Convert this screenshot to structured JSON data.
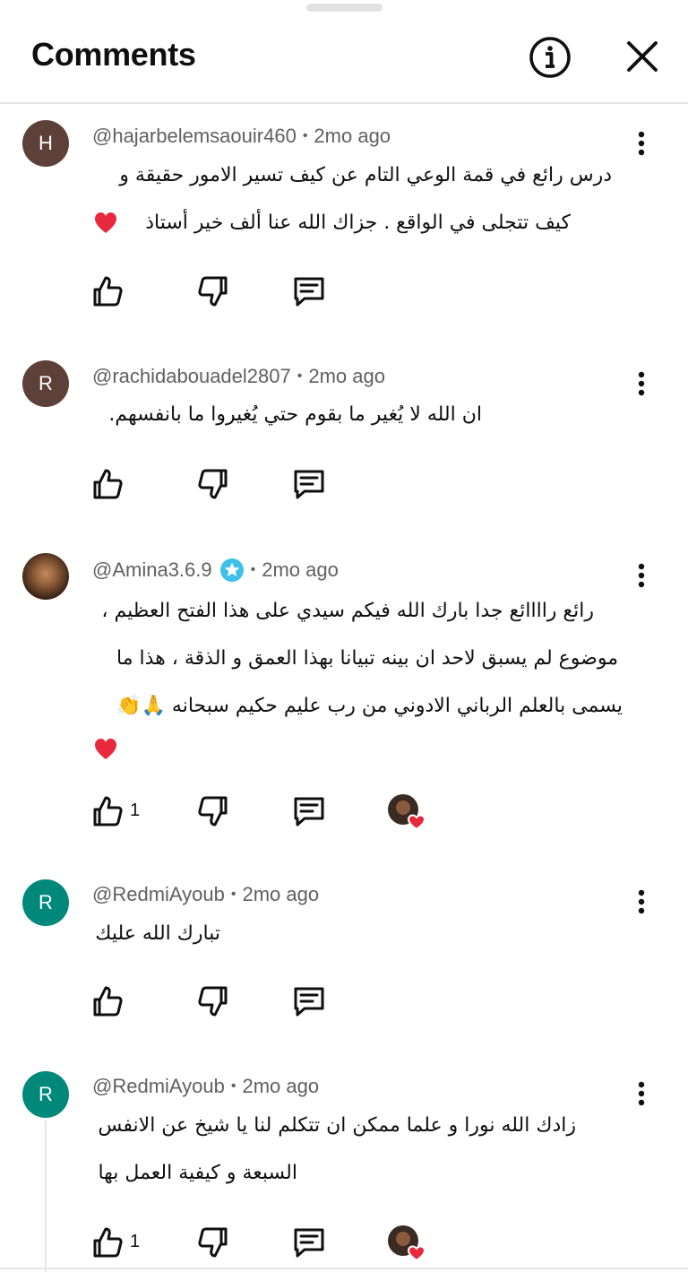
{
  "header": {
    "title": "Comments",
    "info_icon": "info-circle-icon",
    "close_icon": "close-icon"
  },
  "colors": {
    "avatar_brown": "#5d4037",
    "avatar_teal": "#00897b",
    "meta_gray": "#606060",
    "verified_blue": "#3ec0e8",
    "heart_red": "#e8283c"
  },
  "comments": [
    {
      "author": "@hajarbelemsaouir460",
      "time": "2mo ago",
      "avatar_letter": "H",
      "lines": [
        "درس رائع في قمة الوعي التام  عن كيف تسير الامور  حقيقة و",
        "كيف تتجلى في الواقع . جزاك الله عنا ألف خير أستاذ"
      ],
      "likes": ""
    },
    {
      "author": "@rachidabouadel2807",
      "time": "2mo ago",
      "avatar_letter": "R",
      "lines": [
        "ان الله لا يُغير ما بقوم حتي يُغيروا ما بانفسهم."
      ],
      "likes": ""
    },
    {
      "author": "@Amina3.6.9",
      "time": "2mo ago",
      "avatar_letter": "",
      "lines": [
        "رائع راااائع جدا بارك الله فيكم سيدي على هذا الفتح العظيم ،",
        "موضوع لم يسبق لاحد ان بينه تبيانا بهذا العمق و الذقة ، هذا ما",
        "يسمى بالعلم الرباني الادوني من رب عليم حكيم سبحانه 🙏👏"
      ],
      "likes": "1"
    },
    {
      "author": "@RedmiAyoub",
      "time": "2mo ago",
      "avatar_letter": "R",
      "lines": [
        "تبارك الله عليك"
      ],
      "likes": ""
    },
    {
      "author": "@RedmiAyoub",
      "time": "2mo ago",
      "avatar_letter": "R",
      "lines": [
        "زادك الله نورا و علما ممكن ان تتكلم لنا يا شيخ عن الانفس",
        "السبعة و كيفية العمل بها"
      ],
      "likes": "1"
    }
  ]
}
